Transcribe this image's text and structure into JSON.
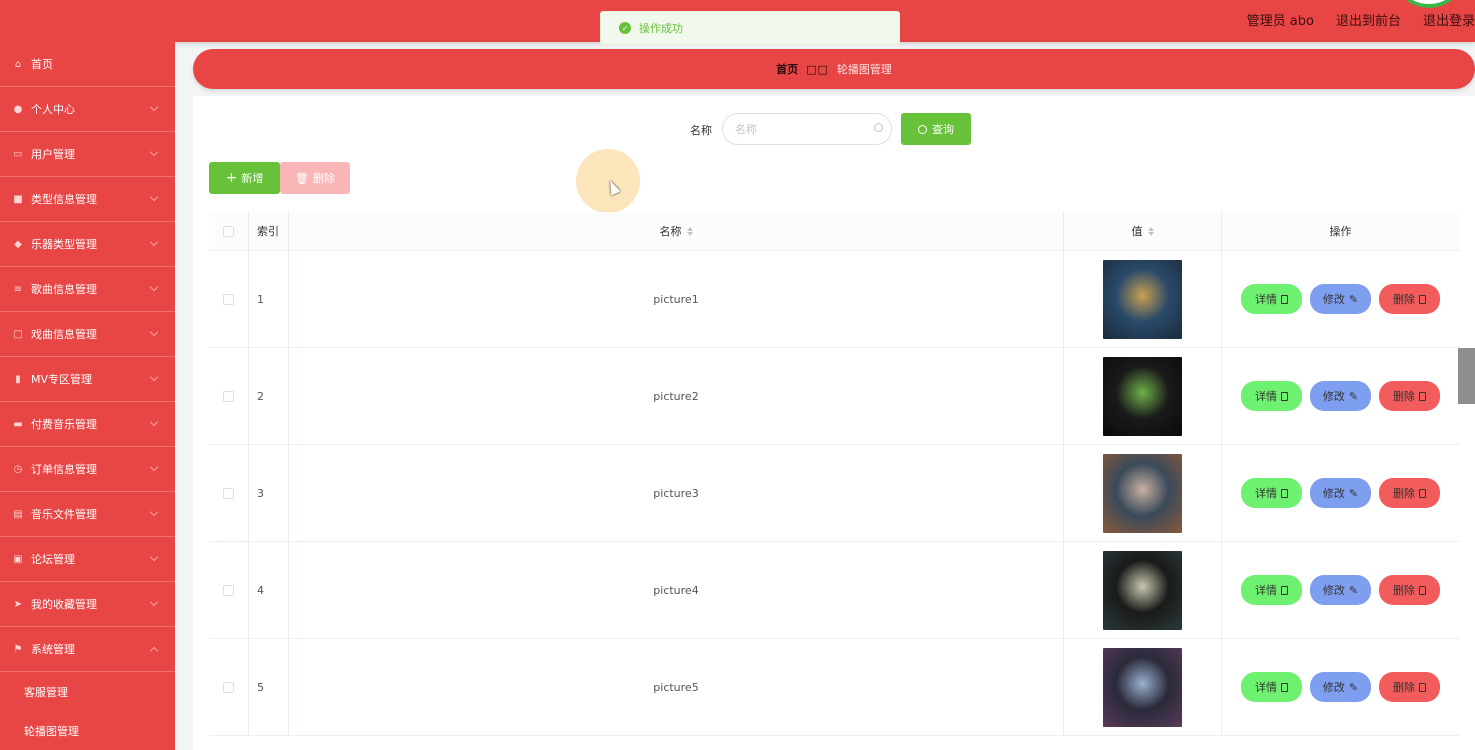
{
  "header": {
    "user_label": "管理员 abo",
    "to_front_label": "退出到前台",
    "logout_label": "退出登录"
  },
  "toast": {
    "message": "操作成功"
  },
  "sidebar": {
    "items": [
      {
        "label": "首页",
        "icon": "home-icon"
      },
      {
        "label": "个人中心",
        "icon": "user-icon"
      },
      {
        "label": "用户管理",
        "icon": "id-card-icon"
      },
      {
        "label": "类型信息管理",
        "icon": "square-check-icon"
      },
      {
        "label": "乐器类型管理",
        "icon": "shield-icon"
      },
      {
        "label": "歌曲信息管理",
        "icon": "sliders-icon"
      },
      {
        "label": "戏曲信息管理",
        "icon": "frame-icon"
      },
      {
        "label": "MV专区管理",
        "icon": "bars-icon"
      },
      {
        "label": "付费音乐管理",
        "icon": "monitor-icon"
      },
      {
        "label": "订单信息管理",
        "icon": "clock-icon"
      },
      {
        "label": "音乐文件管理",
        "icon": "document-icon"
      },
      {
        "label": "论坛管理",
        "icon": "clipboard-icon"
      },
      {
        "label": "我的收藏管理",
        "icon": "send-icon"
      },
      {
        "label": "系统管理",
        "icon": "flag-icon"
      }
    ],
    "sub_items": [
      {
        "label": "客服管理"
      },
      {
        "label": "轮播图管理"
      }
    ]
  },
  "breadcrumb": {
    "home": "首页",
    "separator": "□□",
    "current": "轮播图管理"
  },
  "search": {
    "label": "名称",
    "placeholder": "名称",
    "value": "",
    "query_button": "查询"
  },
  "actions": {
    "add_button": "新增",
    "delete_button": "删除"
  },
  "table": {
    "columns": [
      "索引",
      "名称",
      "值",
      "操作"
    ],
    "rows": [
      {
        "index": "1",
        "name": "picture1",
        "thumb_colors": [
          "#1a2b3a",
          "#c8a050",
          "#2a4a6a"
        ]
      },
      {
        "index": "2",
        "name": "picture2",
        "thumb_colors": [
          "#0a0a0a",
          "#6fb04a",
          "#1a1a1a"
        ]
      },
      {
        "index": "3",
        "name": "picture3",
        "thumb_colors": [
          "#8a5a3a",
          "#c8b0a0",
          "#3a4a5a"
        ]
      },
      {
        "index": "4",
        "name": "picture4",
        "thumb_colors": [
          "#2a3a3a",
          "#c8c8b0",
          "#1a1a1a"
        ]
      },
      {
        "index": "5",
        "name": "picture5",
        "thumb_colors": [
          "#5a3a5a",
          "#9ab0d0",
          "#2a2a3a"
        ]
      }
    ],
    "op_labels": {
      "detail": "详情",
      "edit": "修改",
      "delete": "删除"
    }
  },
  "colors": {
    "primary_red": "#e84545",
    "success_green": "#67c23a",
    "detail_btn": "#6ef070",
    "edit_btn": "#7e9ef0",
    "delete_btn": "#f25c5c"
  }
}
